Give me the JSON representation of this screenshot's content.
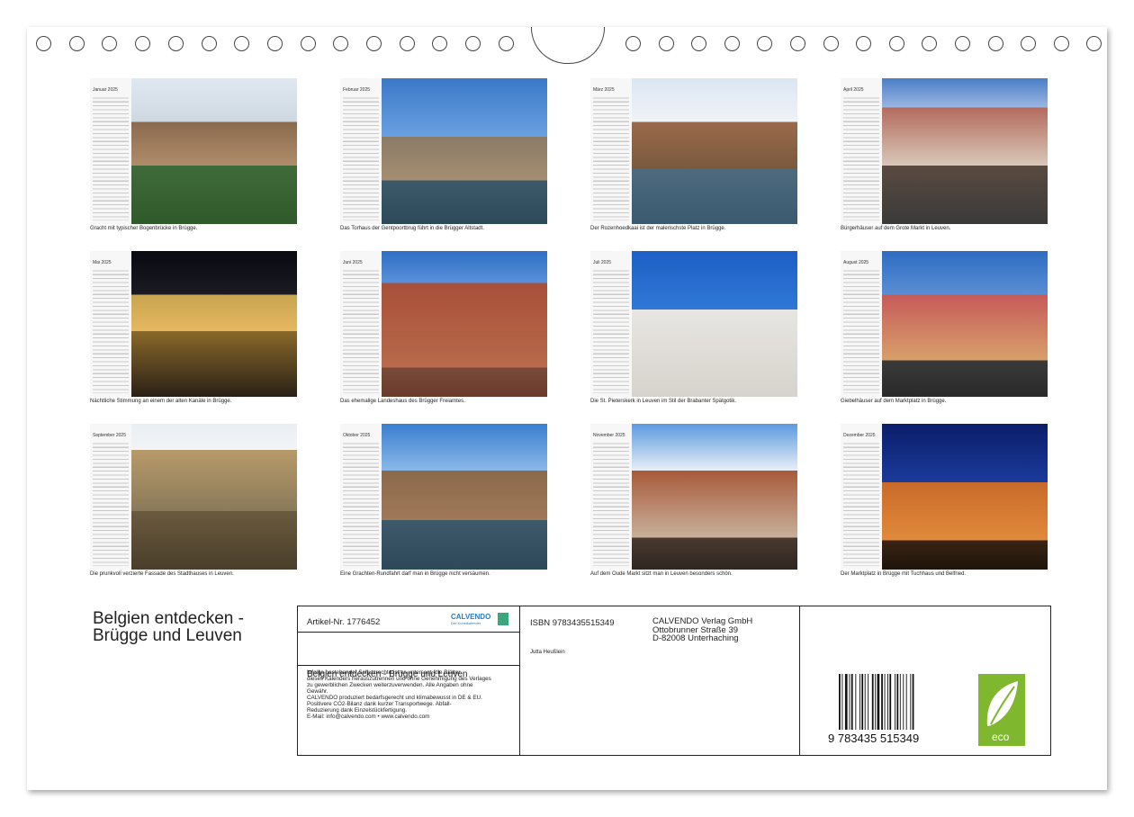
{
  "binding": {
    "left_ring_count": 15,
    "right_ring_count": 15
  },
  "tiles": [
    {
      "month": "Januar 2025",
      "caption": "Gracht mit typischer Bogenbrücke in Brügge."
    },
    {
      "month": "Februar 2025",
      "caption": "Das Torhaus der Gentpoortbrug führt in die Brügger Altstadt."
    },
    {
      "month": "März 2025",
      "caption": "Der Rozenhoedkaai ist der malerischste Platz in Brügge."
    },
    {
      "month": "April 2025",
      "caption": "Bürgerhäuser auf dem Grote Markt in Leuven."
    },
    {
      "month": "Mai 2025",
      "caption": "Nächtliche Stimmung an einem der alten Kanäle in Brügge."
    },
    {
      "month": "Juni 2025",
      "caption": "Das ehemalige Landeshaus des Brügger Freiamtes."
    },
    {
      "month": "Juli 2025",
      "caption": "Die St. Pieterskerk in Leuven im Stil der Brabanter Spätgotik."
    },
    {
      "month": "August 2025",
      "caption": "Giebelhäuser auf dem Marktplatz in Brügge."
    },
    {
      "month": "September 2025",
      "caption": "Die prunkvoll verzierte Fassade des Stadthauses in Leuven."
    },
    {
      "month": "Oktober 2025",
      "caption": "Eine Grachten-Rundfahrt darf man in Brügge nicht versäumen."
    },
    {
      "month": "November 2025",
      "caption": "Auf dem Oude Markt sitzt man in Leuven besonders schön."
    },
    {
      "month": "Dezember 2025",
      "caption": "Der Marktplatz in Brügge mit Tuchhaus und Belfried."
    }
  ],
  "title": {
    "line1": "Belgien entdecken -",
    "line2": "Brügge und Leuven"
  },
  "info": {
    "artikel": "Artikel-Nr. 1776452",
    "brand": "CALVENDO",
    "brand_sub": "Der Kunstkalender",
    "subtitle": "Belgien entdecken - Brügge und Leuven",
    "legal_lines": [
      "Infolge bestehender Schutzrechte ist es untersagt, die Blätter",
      "dieses Kalenders herauszutrennen und ohne Genehmigung des Verlages",
      "zu gewerblichen Zwecken weiterzuverwenden. Alle Angaben ohne",
      "Gewähr.",
      "CALVENDO produziert bedarfsgerecht und klimabewusst in DE & EU.",
      "Positivere CO2-Bilanz dank kurzer Transportwege. Abfall-",
      "Reduzierung dank Einzelstückfertigung.",
      "E-Mail: info@calvendo.com • www.calvendo.com"
    ],
    "isbn": "ISBN 9783435515349",
    "author": "Jutta Heußlein",
    "publisher_lines": [
      "CALVENDO Verlag GmbH",
      "Ottobrunner Straße 39",
      "D-82008 Unterhaching"
    ],
    "barcode_digits": "9 783435 515349",
    "eco_label": "eco"
  },
  "colors": {
    "calvendo_blue": "#2a7bbd",
    "eco_green": "#7fb82e"
  }
}
